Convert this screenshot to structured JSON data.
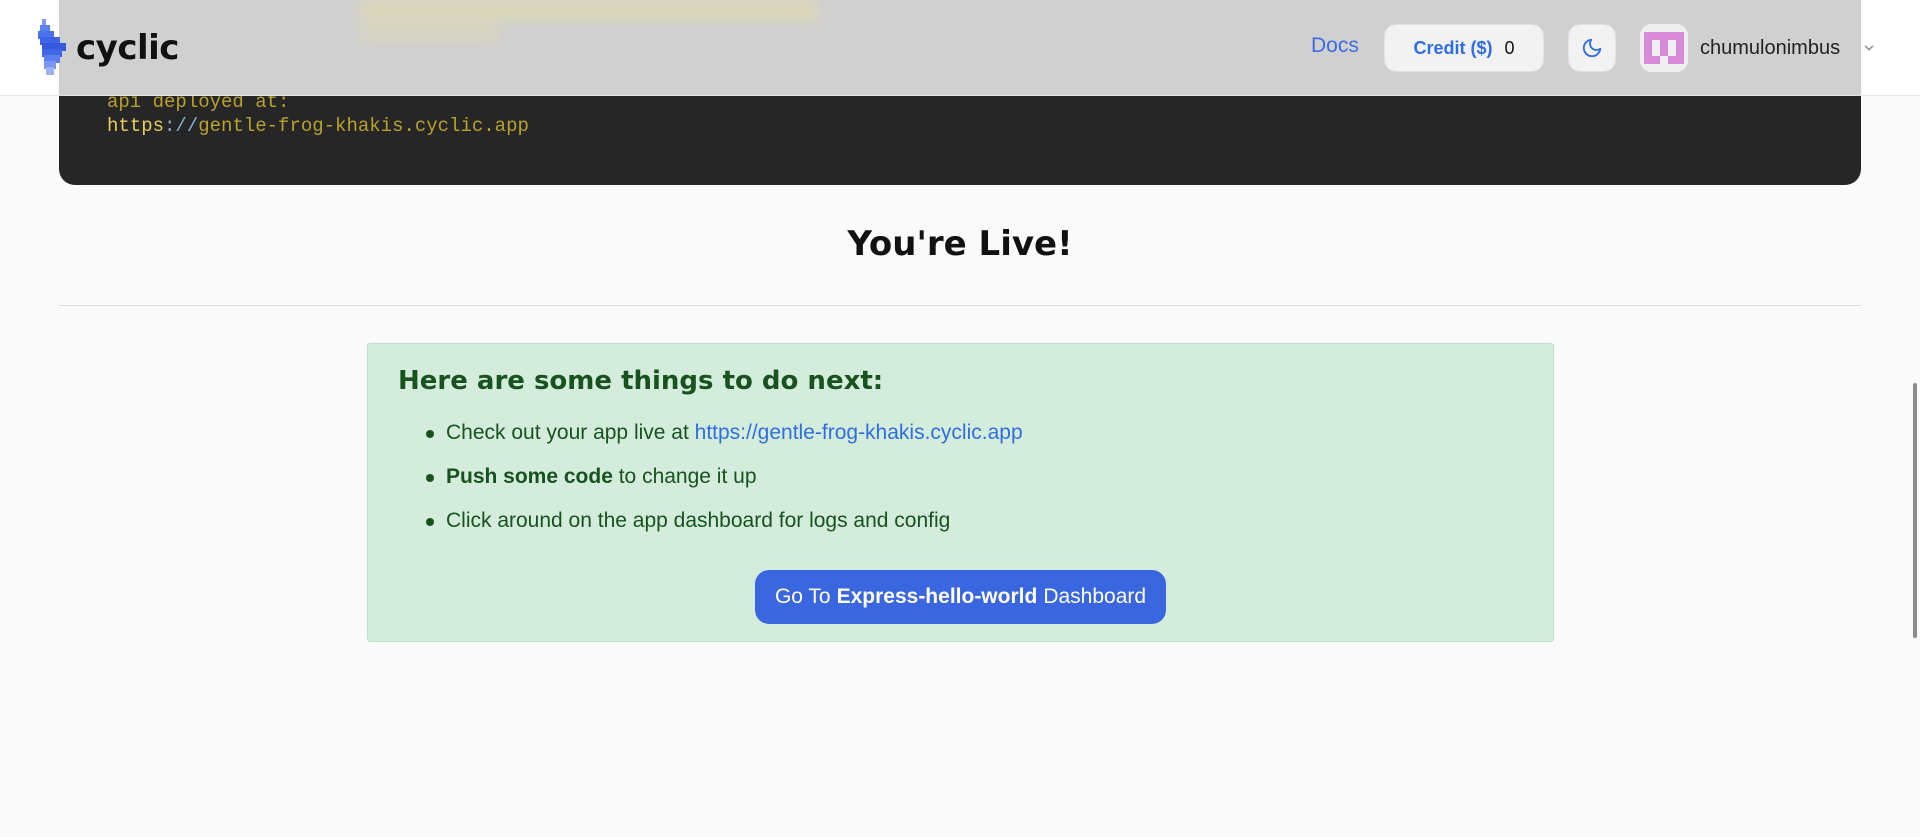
{
  "terminal": {
    "line1": "api deployed at:",
    "url_proto": "https",
    "url_sep": "://",
    "url_host": "gentle-frog-khakis.cyclic.app"
  },
  "header": {
    "logo_text": "cyclic",
    "docs_label": "Docs",
    "credit_label": "Credit ($)",
    "credit_value": "0",
    "theme_icon": "moon-icon",
    "username": "chumulonimbus",
    "dropdown_icon": "chevron-down-icon"
  },
  "main": {
    "title": "You're Live!",
    "next_steps": {
      "heading": "Here are some things to do next:",
      "item1_prefix": "Check out your app live at ",
      "item1_link": "https://gentle-frog-khakis.cyclic.app",
      "item2_bold": "Push some code",
      "item2_rest": " to change it up",
      "item3": "Click around on the app dashboard for logs and config"
    },
    "dashboard_button": {
      "prefix": "Go To",
      "app_name": "Express-hello-world",
      "suffix": "Dashboard"
    }
  },
  "colors": {
    "accent": "#3a66e0",
    "success_bg": "#d4ecdc",
    "success_text": "#17521f",
    "terminal_bg": "#262626"
  }
}
